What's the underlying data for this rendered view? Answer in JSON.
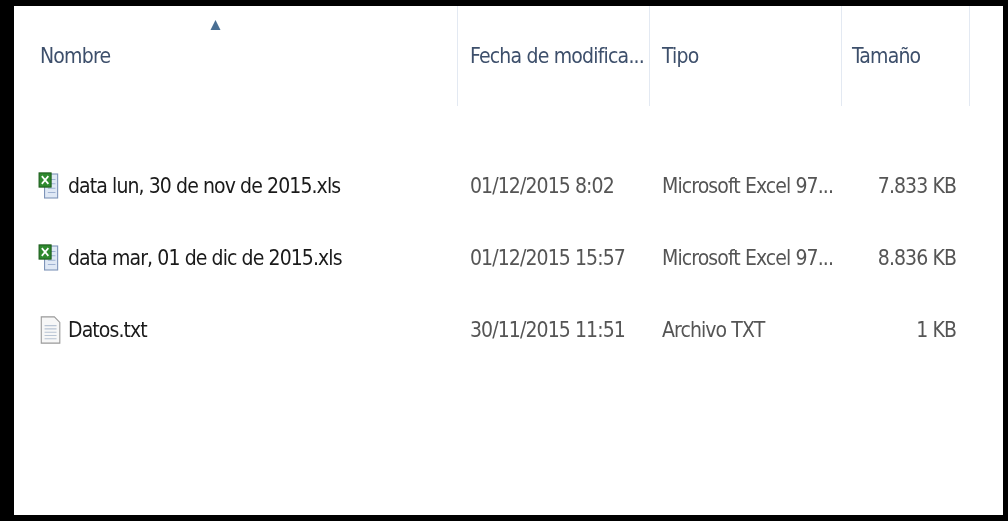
{
  "table": {
    "columns": [
      {
        "label": "Nombre",
        "sorted": true
      },
      {
        "label": "Fecha de modifica...",
        "sorted": false
      },
      {
        "label": "Tipo",
        "sorted": false
      },
      {
        "label": "Tamaño",
        "sorted": false
      }
    ],
    "rows": [
      {
        "kind": "excel",
        "cells": [
          "data lun, 30 de nov de 2015.xls",
          "01/12/2015 8:02",
          "Microsoft Excel 97...",
          "7.833 KB"
        ]
      },
      {
        "kind": "excel",
        "cells": [
          "data mar, 01 de dic de 2015.xls",
          "01/12/2015 15:57",
          "Microsoft Excel 97...",
          "8.836 KB"
        ]
      },
      {
        "kind": "text",
        "cells": [
          "Datos.txt",
          "30/11/2015 11:51",
          "Archivo TXT",
          "1 KB"
        ]
      }
    ]
  }
}
